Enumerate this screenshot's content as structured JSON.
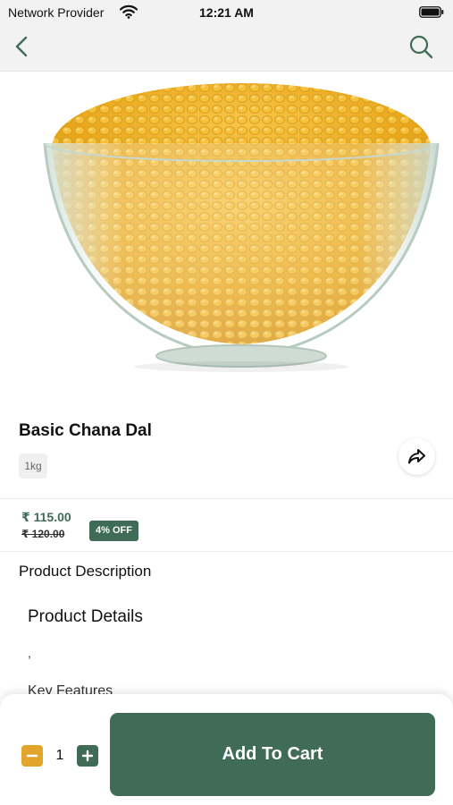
{
  "status_bar": {
    "carrier": "Network Provider",
    "time": "12:21 AM",
    "wifi_icon": "wifi-icon",
    "battery_icon": "battery-icon"
  },
  "nav": {
    "back_icon": "chevron-left-icon",
    "search_icon": "search-icon"
  },
  "product": {
    "name": "Basic Chana Dal",
    "weight": "1kg",
    "price": "₹ 115.00",
    "mrp": "₹ 120.00",
    "discount": "4% OFF",
    "share_icon": "share-icon"
  },
  "description": {
    "heading": "Product Description",
    "details_heading": "Product Details",
    "details_text": ",",
    "key_features": "Key Features"
  },
  "cart": {
    "quantity": "1",
    "add_label": "Add To Cart",
    "minus_icon": "minus-icon",
    "plus_icon": "plus-icon"
  },
  "colors": {
    "accent_green": "#3f6b57",
    "accent_yellow": "#e2a42b",
    "bar_bg": "#f2f2f2"
  }
}
